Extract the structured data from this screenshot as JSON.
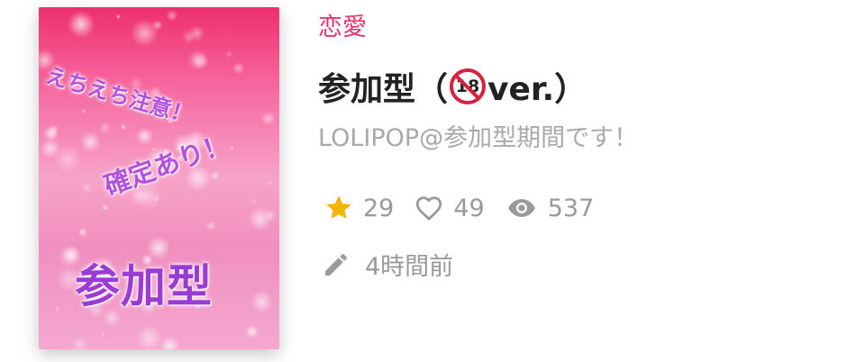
{
  "cover": {
    "line1": "えちえち注意！",
    "line2": "確定あり！",
    "line3": "参加型"
  },
  "category": "恋愛",
  "title": {
    "prefix": "参加型（",
    "badge": "18",
    "suffix": "ver.）"
  },
  "subtitle": "LOLIPOP@参加型期間です！",
  "stats": {
    "stars": "29",
    "likes": "49",
    "views": "537"
  },
  "updated": "4時間前",
  "icons": {
    "star": "star-icon",
    "heart": "heart-outline-icon",
    "eye": "eye-icon",
    "pencil": "pencil-icon",
    "badge": "no-under-18-icon"
  },
  "colors": {
    "category": "#e8356d",
    "star": "#f5b400",
    "muted": "#9a9a9a",
    "title": "#222222"
  }
}
